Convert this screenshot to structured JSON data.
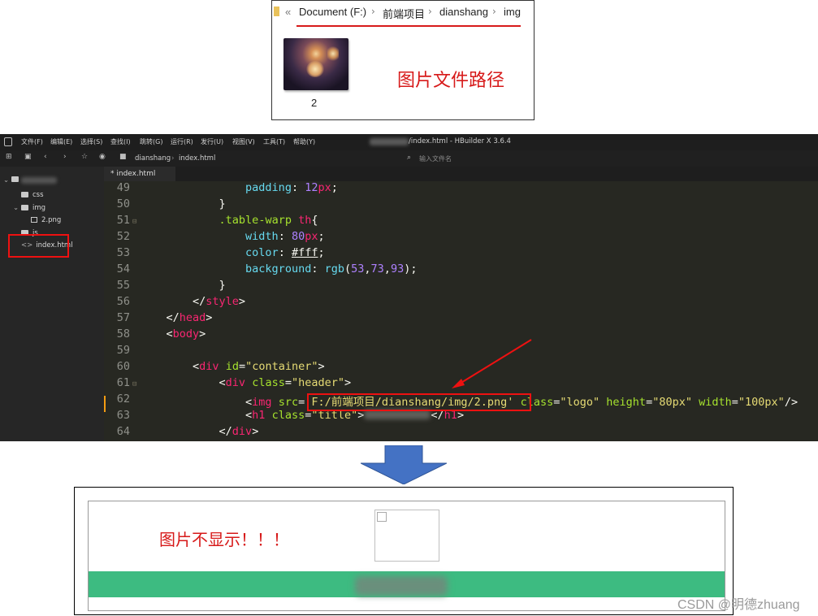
{
  "explorer": {
    "nav_chevron": "«",
    "breadcrumb": [
      "Document (F:)",
      "前端项目",
      "dianshang",
      "img"
    ],
    "separator": "›",
    "file_label": "2",
    "note": "图片文件路径"
  },
  "editor": {
    "window_title": "/index.html - HBuilder X 3.6.4",
    "menu": [
      "文件(F)",
      "编辑(E)",
      "选择(S)",
      "查找(I)",
      "跳转(G)",
      "运行(R)",
      "发行(U)",
      "视图(V)",
      "工具(T)",
      "帮助(Y)"
    ],
    "toolbar_breadcrumb": [
      "dianshang",
      "index.html"
    ],
    "search_placeholder": "输入文件名",
    "tab": "* index.html",
    "tree": {
      "css": "css",
      "img": "img",
      "png": "2.png",
      "js": "js",
      "index": "index.html"
    },
    "lines": [
      "49",
      "50",
      "51",
      "52",
      "53",
      "54",
      "55",
      "56",
      "57",
      "58",
      "59",
      "60",
      "61",
      "62",
      "63",
      "64"
    ],
    "code": {
      "l49_prop": "padding",
      "l49_val": "12",
      "l49_unit": "px",
      "l51_sel": ".table-warp ",
      "l51_tag": "th",
      "l52_prop": "width",
      "l52_val": "80",
      "l52_unit": "px",
      "l53_prop": "color",
      "l53_val": "#fff",
      "l54_prop": "background",
      "l54_fn": "rgb",
      "l54_a": "53",
      "l54_b": "73",
      "l54_c": "93",
      "style": "style",
      "head": "head",
      "body": "body",
      "div": "div",
      "id_attr": "id",
      "id_val": "\"container\"",
      "class_attr": "class",
      "header_val": "\"header\"",
      "img": "img",
      "src_attr": "src",
      "src_val": "'F:/前端项目/dianshang/img/2.png'",
      "logo_val": "\"logo\"",
      "height_attr": "height",
      "height_val": "\"80px\"",
      "width_attr": "width",
      "width_val": "\"100px\"",
      "h1": "h1",
      "title_val": "\"title\""
    }
  },
  "result": {
    "message": "图片不显示！！！"
  },
  "watermark": "CSDN @明德zhuang",
  "colors": {
    "annotation_red": "#d71a1a",
    "arrow_blue": "#4472c4",
    "header_green": "#3dbb81"
  }
}
